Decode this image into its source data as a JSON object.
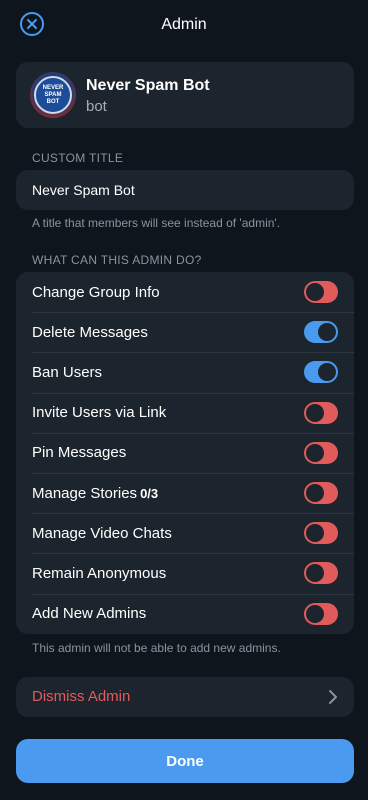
{
  "header": {
    "title": "Admin",
    "close_icon": "close-icon"
  },
  "profile": {
    "name": "Never Spam Bot",
    "subtitle": "bot",
    "avatar_lines": [
      "NEVER",
      "SPAM",
      "BOT"
    ]
  },
  "custom_title": {
    "section_label": "CUSTOM TITLE",
    "value": "Never Spam Bot",
    "hint": "A title that members will see instead of 'admin'."
  },
  "permissions": {
    "section_label": "WHAT CAN THIS ADMIN DO?",
    "items": [
      {
        "label": "Change Group Info",
        "count": "",
        "enabled": false
      },
      {
        "label": "Delete Messages",
        "count": "",
        "enabled": true
      },
      {
        "label": "Ban Users",
        "count": "",
        "enabled": true
      },
      {
        "label": "Invite Users via Link",
        "count": "",
        "enabled": false
      },
      {
        "label": "Pin Messages",
        "count": "",
        "enabled": false
      },
      {
        "label": "Manage Stories",
        "count": "0/3",
        "enabled": false
      },
      {
        "label": "Manage Video Chats",
        "count": "",
        "enabled": false
      },
      {
        "label": "Remain Anonymous",
        "count": "",
        "enabled": false
      },
      {
        "label": "Add New Admins",
        "count": "",
        "enabled": false
      }
    ],
    "footer_hint": "This admin will not be able to add new admins."
  },
  "dismiss": {
    "label": "Dismiss Admin"
  },
  "done_button": {
    "label": "Done"
  },
  "colors": {
    "accent": "#4a9bf0",
    "danger": "#e15b5b",
    "background": "#0f151d",
    "card": "#1c242e"
  }
}
